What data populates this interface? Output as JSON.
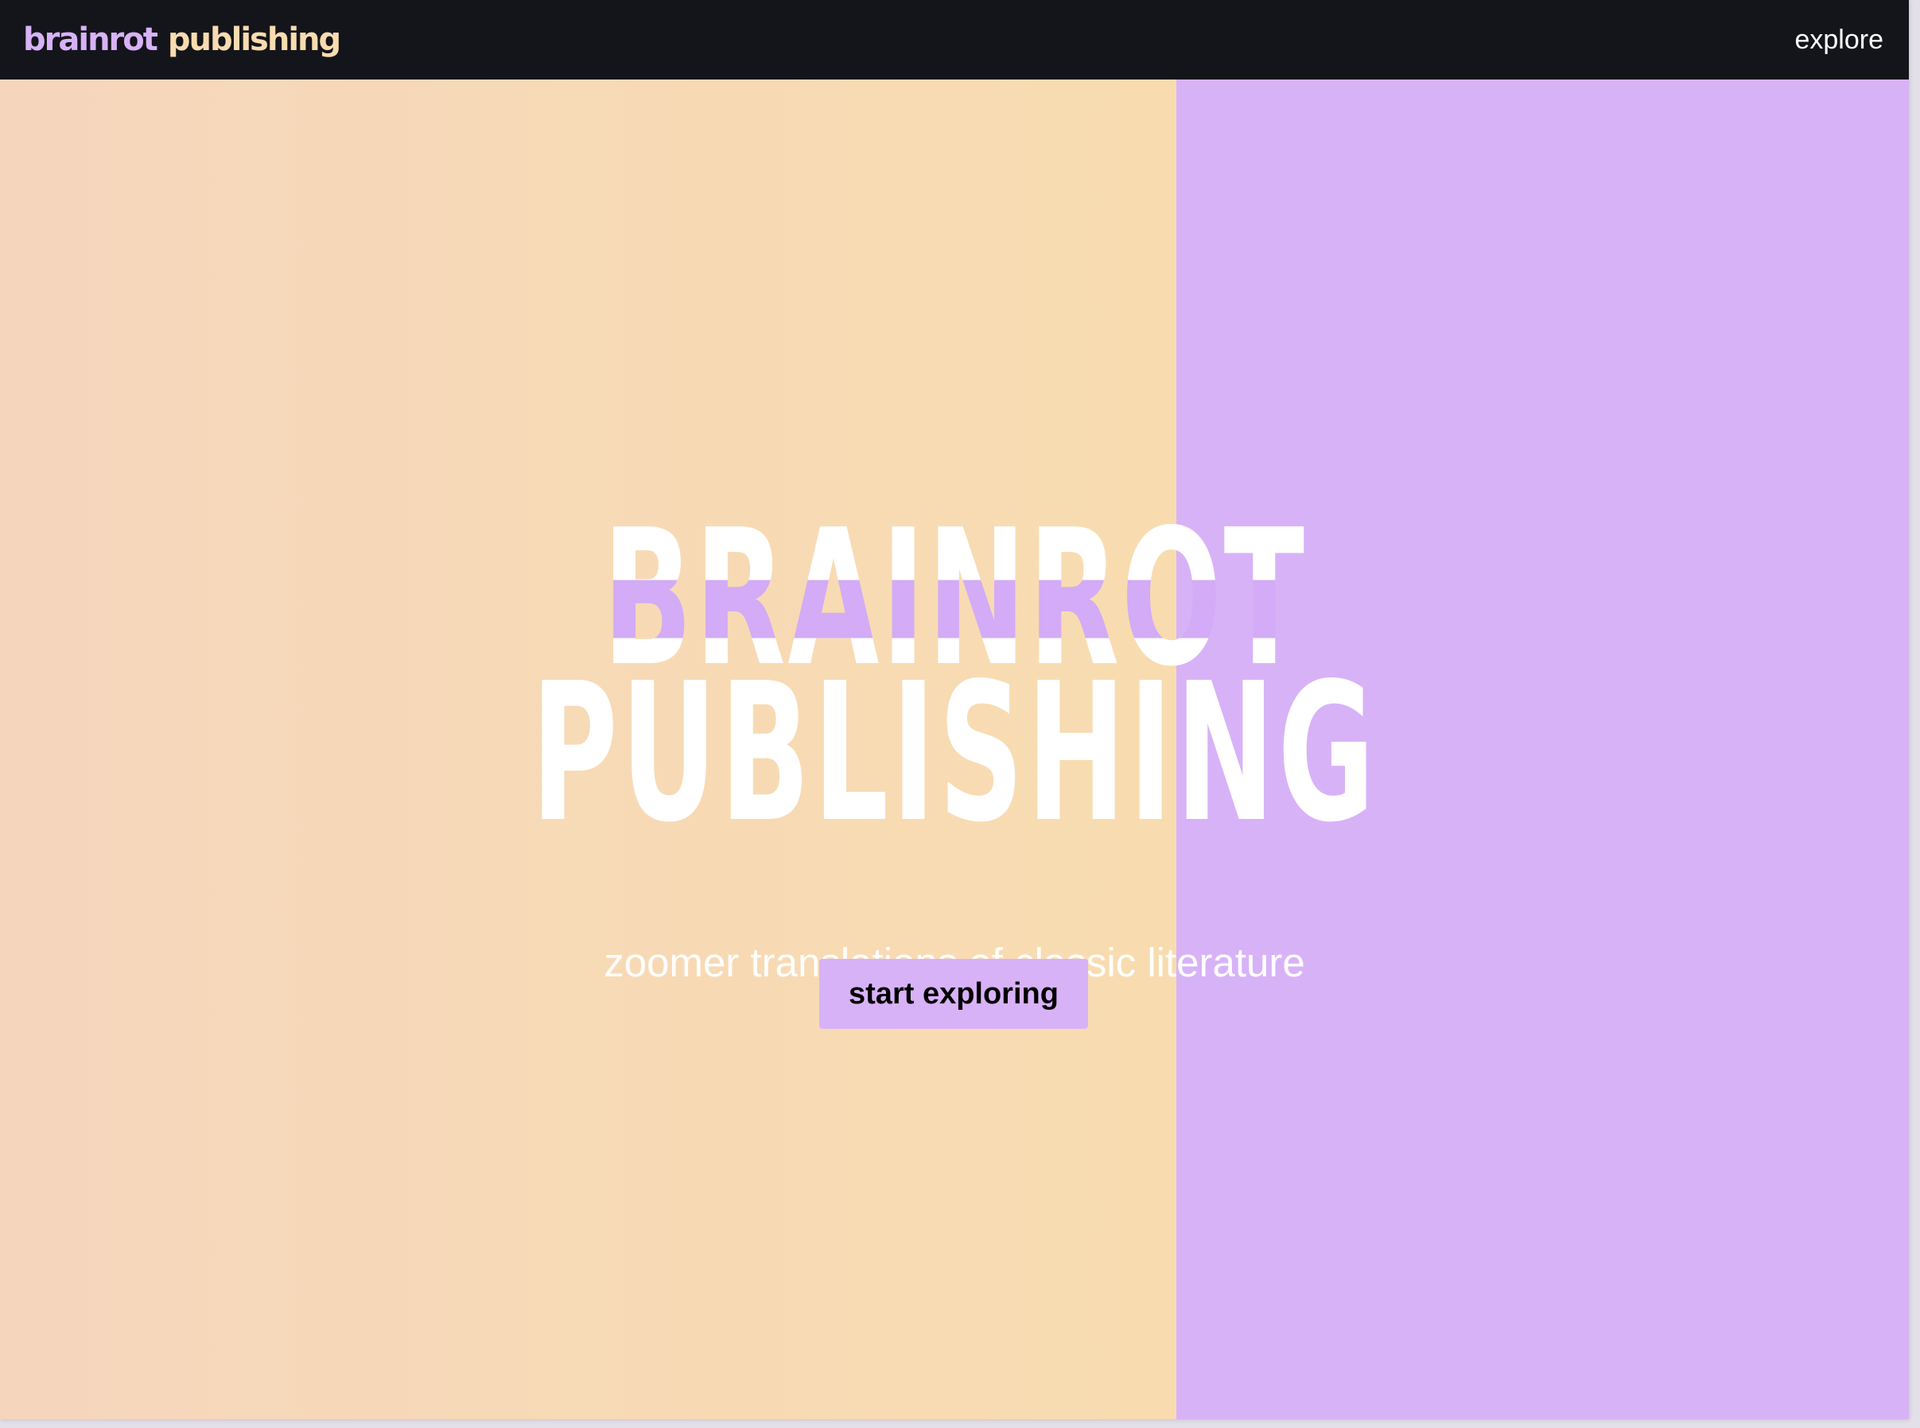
{
  "colors": {
    "topbar": "#14151a",
    "accent_purple": "#d8b2f7",
    "accent_peach": "#f8dcb0",
    "hero_text": "#ffffff",
    "button_text": "#000000"
  },
  "header": {
    "logo_part1": "brainrot",
    "logo_part2": "publishing",
    "nav_explore": "explore"
  },
  "hero": {
    "title_line1": "BRAINROT",
    "title_line2": "PUBLISHING",
    "tagline": "zoomer translations of classic literature",
    "cta_label": "start exploring"
  }
}
